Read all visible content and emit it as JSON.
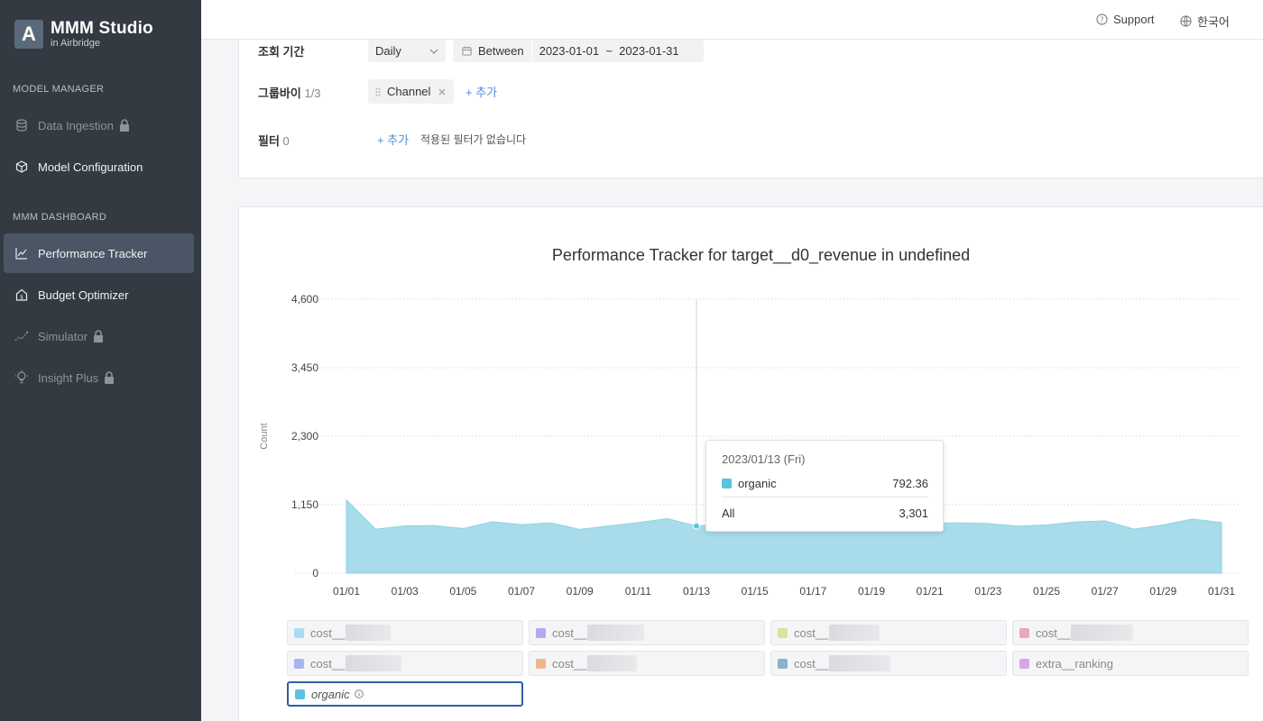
{
  "app": {
    "name": "MMM Studio",
    "sub": "in Airbridge",
    "logo_letter": "A"
  },
  "sidebar": {
    "sections": [
      {
        "title": "MODEL MANAGER"
      },
      {
        "title": "MMM DASHBOARD"
      }
    ],
    "items": [
      {
        "label": "Data Ingestion",
        "icon": "database-icon",
        "locked": true
      },
      {
        "label": "Model Configuration",
        "icon": "cube-icon",
        "locked": false
      },
      {
        "label": "Performance Tracker",
        "icon": "line-chart-icon",
        "locked": false,
        "active": true
      },
      {
        "label": "Budget Optimizer",
        "icon": "house-dollar-icon",
        "locked": false
      },
      {
        "label": "Simulator",
        "icon": "scatter-icon",
        "locked": true
      },
      {
        "label": "Insight Plus",
        "icon": "bulb-icon",
        "locked": true
      }
    ]
  },
  "topbar": {
    "support": "Support",
    "language": "한국어"
  },
  "filters": {
    "period_label": "조회 기간",
    "granularity": "Daily",
    "date_mode": "Between",
    "date_range": "2023-01-01  ~  2023-01-31",
    "groupby_label": "그룹바이",
    "groupby_count": "1/3",
    "groupby_chip": "Channel",
    "add_label": "+ 추가",
    "filter_label": "필터",
    "filter_count": "0",
    "no_filter_text": "적용된 필터가 없습니다"
  },
  "chart_data": {
    "type": "area",
    "title": "Performance Tracker for target__d0_revenue in undefined",
    "ylabel": "Count",
    "ylim": [
      0,
      4600
    ],
    "yticks": [
      "4,600",
      "3,450",
      "2,300",
      "1,150",
      "0"
    ],
    "x": [
      "01/01",
      "01/02",
      "01/03",
      "01/04",
      "01/05",
      "01/06",
      "01/07",
      "01/08",
      "01/09",
      "01/10",
      "01/11",
      "01/12",
      "01/13",
      "01/14",
      "01/15",
      "01/16",
      "01/17",
      "01/18",
      "01/19",
      "01/20",
      "01/21",
      "01/22",
      "01/23",
      "01/24",
      "01/25",
      "01/26",
      "01/27",
      "01/28",
      "01/29",
      "01/30",
      "01/31"
    ],
    "xtick_labels": [
      "01/01",
      "01/03",
      "01/05",
      "01/07",
      "01/09",
      "01/11",
      "01/13",
      "01/15",
      "01/17",
      "01/19",
      "01/21",
      "01/23",
      "01/25",
      "01/27",
      "01/29",
      "01/31"
    ],
    "series": [
      {
        "name": "organic",
        "color": "#5bc3dd",
        "values": [
          1230,
          740,
          795,
          800,
          750,
          865,
          815,
          845,
          735,
          795,
          850,
          915,
          792,
          830,
          860,
          845,
          830,
          850,
          845,
          835,
          840,
          845,
          835,
          790,
          810,
          860,
          880,
          740,
          810,
          910,
          850
        ]
      }
    ],
    "highlight_index": 12
  },
  "tooltip": {
    "date": "2023/01/13 (Fri)",
    "series_name": "organic",
    "series_value": "792.36",
    "total_label": "All",
    "total_value": "3,301"
  },
  "legend": [
    {
      "label": "cost__",
      "color": "#a9dcf2",
      "selected": false
    },
    {
      "label": "cost__",
      "color": "#b7a6f2",
      "selected": false
    },
    {
      "label": "cost__",
      "color": "#d8e59a",
      "selected": false
    },
    {
      "label": "cost__",
      "color": "#e8a8b8",
      "selected": false
    },
    {
      "label": "cost__",
      "color": "#a7b5ee",
      "selected": false
    },
    {
      "label": "cost__",
      "color": "#f0b58e",
      "selected": false
    },
    {
      "label": "cost__",
      "color": "#8bb1cc",
      "selected": false
    },
    {
      "label": "extra__ranking",
      "color": "#d9a3ee",
      "selected": false
    },
    {
      "label": "organic",
      "color": "#5bc3dd",
      "selected": true
    }
  ]
}
